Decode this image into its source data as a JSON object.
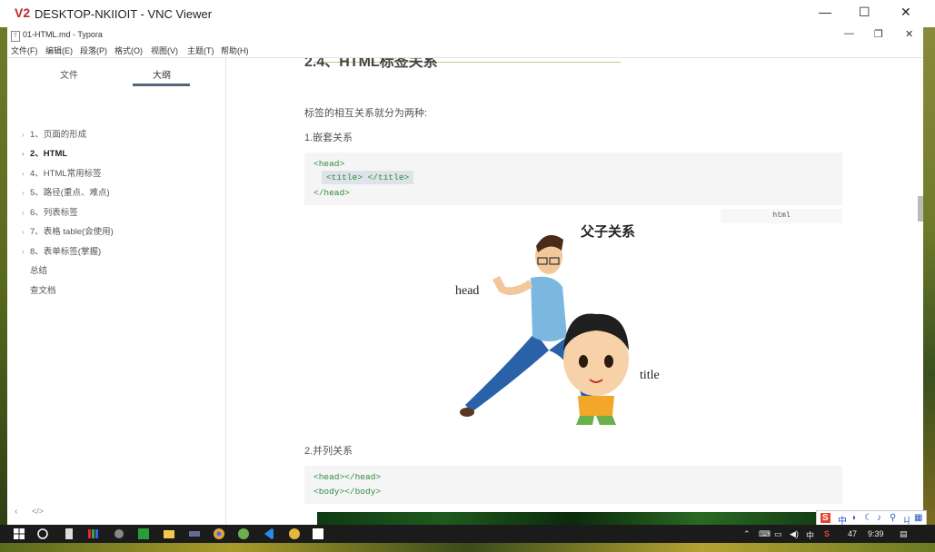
{
  "vnc": {
    "logo": "V2",
    "title": "DESKTOP-NKIIOIT - VNC Viewer",
    "minimize": "—",
    "maximize": "☐",
    "close": "✕"
  },
  "typora": {
    "title": "01-HTML.md - Typora",
    "icon": "T",
    "minimize": "—",
    "restore": "❐",
    "close": "✕",
    "menu": [
      "文件(F)",
      "编辑(E)",
      "段落(P)",
      "格式(O)",
      "视图(V)",
      "主题(T)",
      "帮助(H)"
    ]
  },
  "sidebar": {
    "tabs": [
      "文件",
      "大纲"
    ],
    "active_tab": "大纲",
    "outline": [
      {
        "label": "1、页面的形成",
        "arrow": "›",
        "bold": false
      },
      {
        "label": "2、HTML",
        "arrow": "›",
        "bold": true
      },
      {
        "label": "4、HTML常用标签",
        "arrow": "›",
        "bold": false
      },
      {
        "label": "5、路径(重点、难点)",
        "arrow": "›",
        "bold": false
      },
      {
        "label": "6、列表标签",
        "arrow": "›",
        "bold": false
      },
      {
        "label": "7、表格 table(会使用)",
        "arrow": "›",
        "bold": false
      },
      {
        "label": "8、表单标签(掌握)",
        "arrow": "›",
        "bold": false
      },
      {
        "label": "总结",
        "arrow": "",
        "bold": false
      },
      {
        "label": "查文档",
        "arrow": "",
        "bold": false
      }
    ],
    "footer_back": "‹",
    "footer_source": "</>"
  },
  "editor": {
    "cut_heading": "2.4、HTML标签关系",
    "intro": "标签的相互关系就分为两种:",
    "nest_title": "1.嵌套关系",
    "code1": [
      "<head>",
      "<title> </title>",
      "</head>"
    ],
    "code1_lang": "html",
    "illustration": {
      "caption": "父子关系",
      "left_label": "head",
      "right_label": "title"
    },
    "parallel_title": "2.并列关系",
    "code2": [
      "<head></head>",
      "<body></body>"
    ]
  },
  "taskbar": {
    "time": "9:39",
    "tray_number": "47",
    "ime_lang": "中",
    "ime_bar": [
      "S",
      "中",
      "◗",
      "☾",
      "♪",
      "⚲",
      "ㄐ",
      "▦"
    ]
  },
  "colors": {
    "code_text": "#2e8b3f",
    "code_bg": "#f5f5f5",
    "accent_underline": "#55657a",
    "vnc_logo": "#c0282a"
  }
}
